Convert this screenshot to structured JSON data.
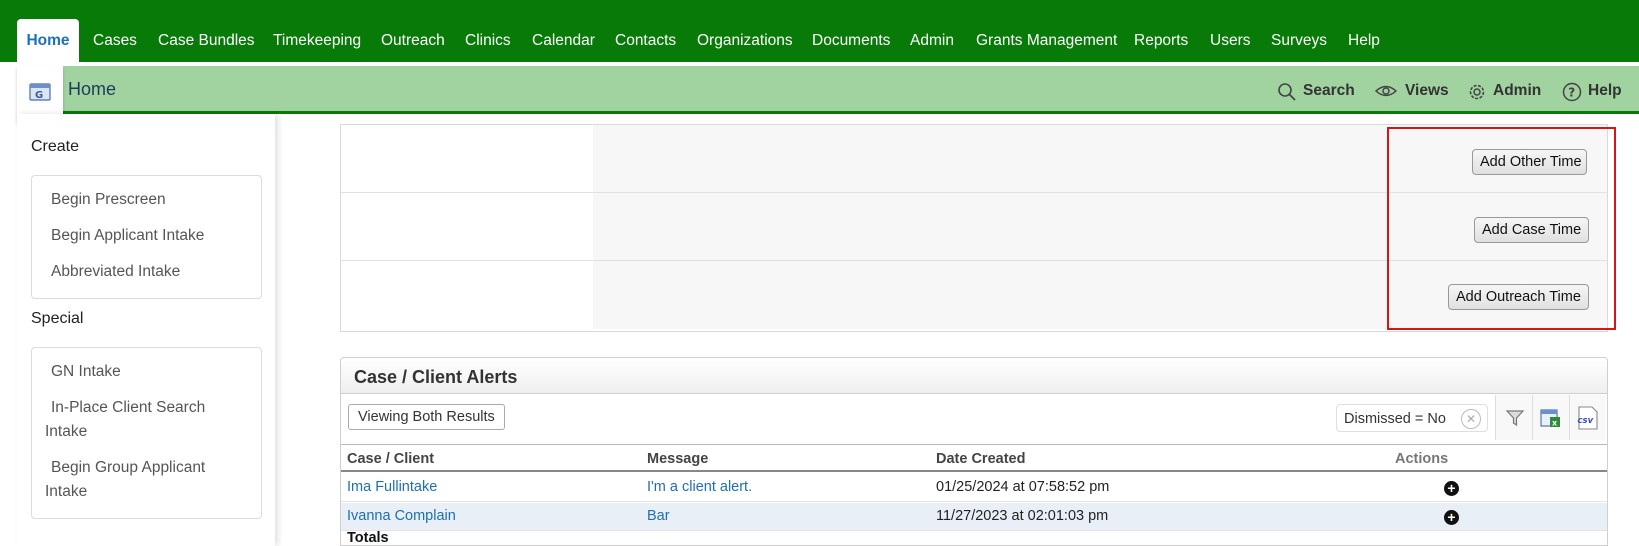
{
  "nav": {
    "tabs": [
      "Home",
      "Cases",
      "Case Bundles",
      "Timekeeping",
      "Outreach",
      "Clinics",
      "Calendar",
      "Contacts",
      "Organizations",
      "Documents",
      "Admin",
      "Grants Management",
      "Reports",
      "Users",
      "Surveys",
      "Help"
    ],
    "active_tab": "Home"
  },
  "header": {
    "title": "Home",
    "search_label": "Search",
    "views_label": "Views",
    "admin_label": "Admin",
    "help_label": "Help"
  },
  "sidebar": {
    "create_title": "Create",
    "create_items": [
      "Begin Prescreen",
      "Begin Applicant Intake",
      "Abbreviated Intake"
    ],
    "special_title": "Special",
    "special_items": [
      "GN Intake",
      "In-Place Client Search",
      "Intake",
      "Begin Group Applicant",
      "Intake"
    ]
  },
  "time_buttons": {
    "other": "Add Other Time",
    "case": "Add Case Time",
    "outreach": "Add Outreach Time"
  },
  "alerts": {
    "title": "Case / Client Alerts",
    "view_button": "Viewing Both Results",
    "filter": "Dismissed = No",
    "columns": [
      "Case / Client",
      "Message",
      "Date Created",
      "Actions"
    ],
    "rows": [
      {
        "client": "Ima Fullintake",
        "message": "I'm a client alert.",
        "date": "01/25/2024 at 07:58:52 pm"
      },
      {
        "client": "Ivanna Complain",
        "message": "Bar",
        "date": "11/27/2023 at 02:01:03 pm"
      }
    ],
    "totals_label": "Totals"
  },
  "colors": {
    "nav_green": "#077a07",
    "band_green": "#a1d3a1",
    "link_blue": "#1d6fb0",
    "highlight_red": "#d81414",
    "selected_row": "#e8eff6"
  },
  "icons": [
    "home-icon",
    "search-icon",
    "eye-icon",
    "gear-icon",
    "help-circle-icon",
    "filter-icon",
    "excel-export-icon",
    "csv-export-icon",
    "clear-filter-icon",
    "add-action-icon"
  ]
}
